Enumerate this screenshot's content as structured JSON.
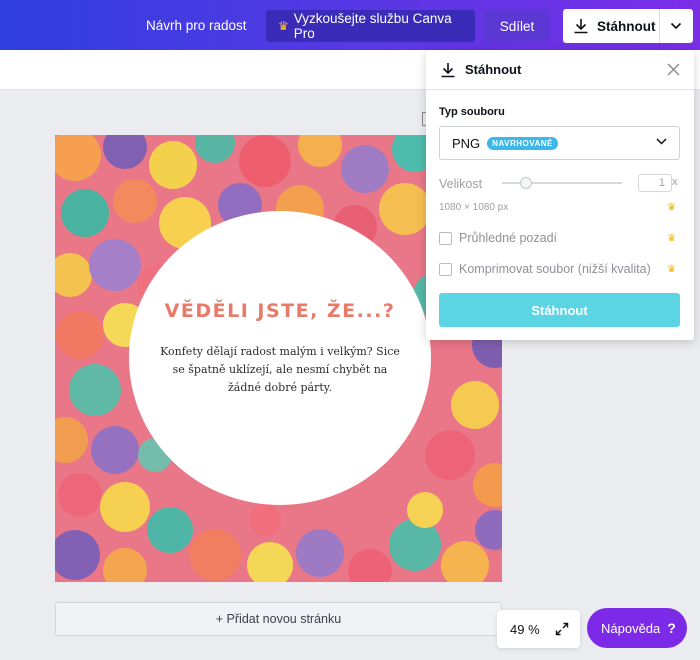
{
  "topbar": {
    "design_title": "Návrh pro radost",
    "pro_label": "Vyzkoušejte službu Canva Pro",
    "share_label": "Sdílet",
    "download_label": "Stáhnout"
  },
  "design": {
    "heading": "VĚDĚLI JSTE, ŽE...?",
    "body": "Konfety dělají radost malým i velkým? Sice se špatně uklízejí, ale nesmí chybět na žádné dobré párty."
  },
  "add_page_label": "+ Přidat novou stránku",
  "zoom": {
    "value": "49 %"
  },
  "help": {
    "label": "Nápověda",
    "icon": "?"
  },
  "download_panel": {
    "title": "Stáhnout",
    "file_type_label": "Typ souboru",
    "file_type_value": "PNG",
    "recommended_badge": "NAVRHOVANÉ",
    "size_label": "Velikost",
    "size_value": "1",
    "size_suffix": "x",
    "size_fraction": 0.2,
    "dimensions": "1080 × 1080 px",
    "transparent_label": "Průhledné pozadí",
    "compress_label": "Komprimovat soubor (nižší kvalita)",
    "download_button": "Stáhnout"
  },
  "colors": {
    "topbar_start": "#2f3fe0",
    "topbar_end": "#7a2ee6",
    "help_bg": "#7d2ae8",
    "download_button": "#5bd4e3",
    "badge": "#3bb7e8",
    "heading": "#e77a68",
    "crown": "#f4b400"
  }
}
